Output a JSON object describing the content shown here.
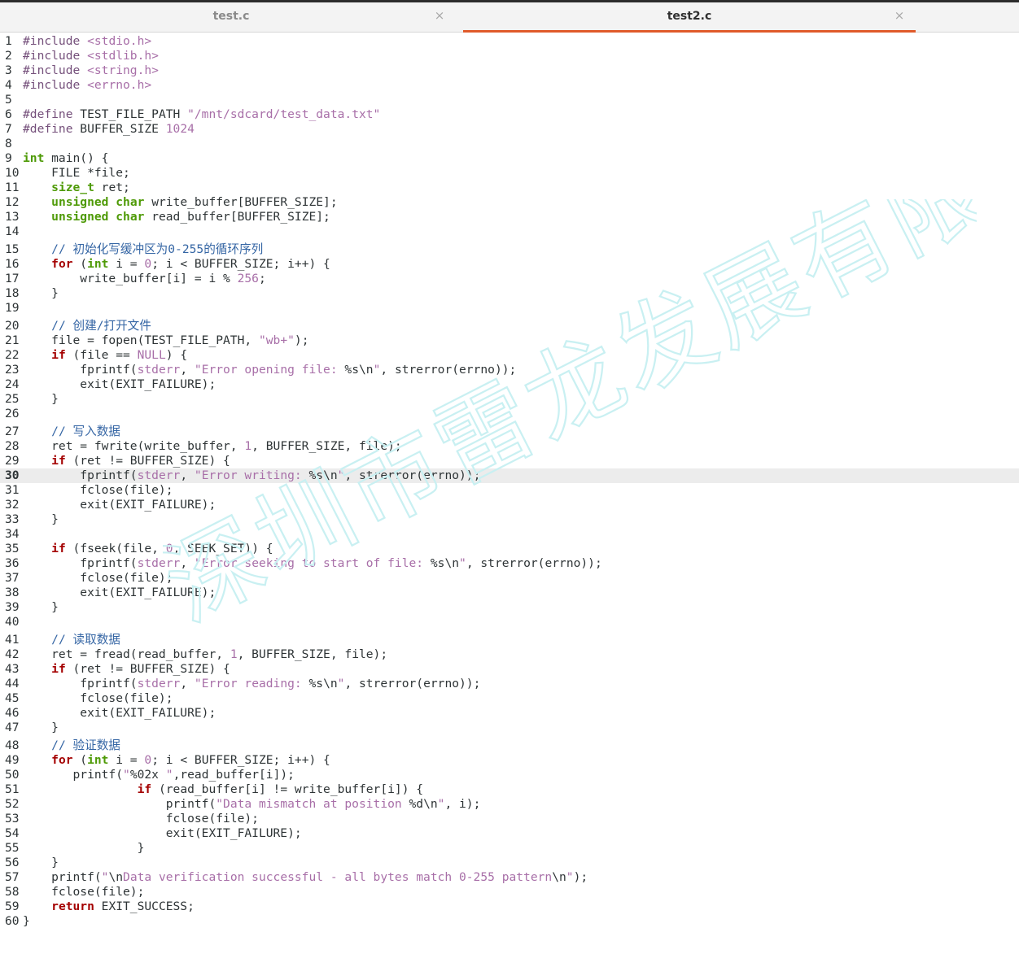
{
  "tabs": [
    {
      "label": "test.c",
      "active": false,
      "close_icon": "×"
    },
    {
      "label": "test2.c",
      "active": true,
      "close_icon": "×"
    }
  ],
  "colors": {
    "keyword": "#4e9a06",
    "control": "#a40000",
    "preproc": "#75507b",
    "string": "#a86fa8",
    "number": "#a86fa8",
    "comment": "#3465a4",
    "default": "#2e3436",
    "active_tab_underline": "#e05a2a",
    "current_line_bg": "#ececec",
    "watermark": "#c9f0f2"
  },
  "watermark": "深圳市雷龙发展有限公司",
  "current_line": 30,
  "editor": {
    "lines": [
      "#include <stdio.h>",
      "#include <stdlib.h>",
      "#include <string.h>",
      "#include <errno.h>",
      "",
      "#define TEST_FILE_PATH \"/mnt/sdcard/test_data.txt\"",
      "#define BUFFER_SIZE 1024",
      "",
      "int main() {",
      "    FILE *file;",
      "    size_t ret;",
      "    unsigned char write_buffer[BUFFER_SIZE];",
      "    unsigned char read_buffer[BUFFER_SIZE];",
      "",
      "    // 初始化写缓冲区为0-255的循环序列",
      "    for (int i = 0; i < BUFFER_SIZE; i++) {",
      "        write_buffer[i] = i % 256;",
      "    }",
      "",
      "    // 创建/打开文件",
      "    file = fopen(TEST_FILE_PATH, \"wb+\");",
      "    if (file == NULL) {",
      "        fprintf(stderr, \"Error opening file: %s\\n\", strerror(errno));",
      "        exit(EXIT_FAILURE);",
      "    }",
      "",
      "    // 写入数据",
      "    ret = fwrite(write_buffer, 1, BUFFER_SIZE, file);",
      "    if (ret != BUFFER_SIZE) {",
      "        fprintf(stderr, \"Error writing: %s\\n\", strerror(errno));",
      "        fclose(file);",
      "        exit(EXIT_FAILURE);",
      "    }",
      "",
      "    if (fseek(file, 0, SEEK_SET)) {",
      "        fprintf(stderr, \"Error seeking to start of file: %s\\n\", strerror(errno));",
      "        fclose(file);",
      "        exit(EXIT_FAILURE);",
      "    }",
      "",
      "    // 读取数据",
      "    ret = fread(read_buffer, 1, BUFFER_SIZE, file);",
      "    if (ret != BUFFER_SIZE) {",
      "        fprintf(stderr, \"Error reading: %s\\n\", strerror(errno));",
      "        fclose(file);",
      "        exit(EXIT_FAILURE);",
      "    }",
      "    // 验证数据",
      "    for (int i = 0; i < BUFFER_SIZE; i++) {",
      "       printf(\"%02x \",read_buffer[i]);",
      "\t\tif (read_buffer[i] != write_buffer[i]) {",
      "\t\t    printf(\"Data mismatch at position %d\\n\", i);",
      "\t\t    fclose(file);",
      "\t\t    exit(EXIT_FAILURE);",
      "\t\t}",
      "    }",
      "    printf(\"\\nData verification successful - all bytes match 0-255 pattern\\n\");",
      "    fclose(file);",
      "    return EXIT_SUCCESS;",
      "}"
    ]
  }
}
